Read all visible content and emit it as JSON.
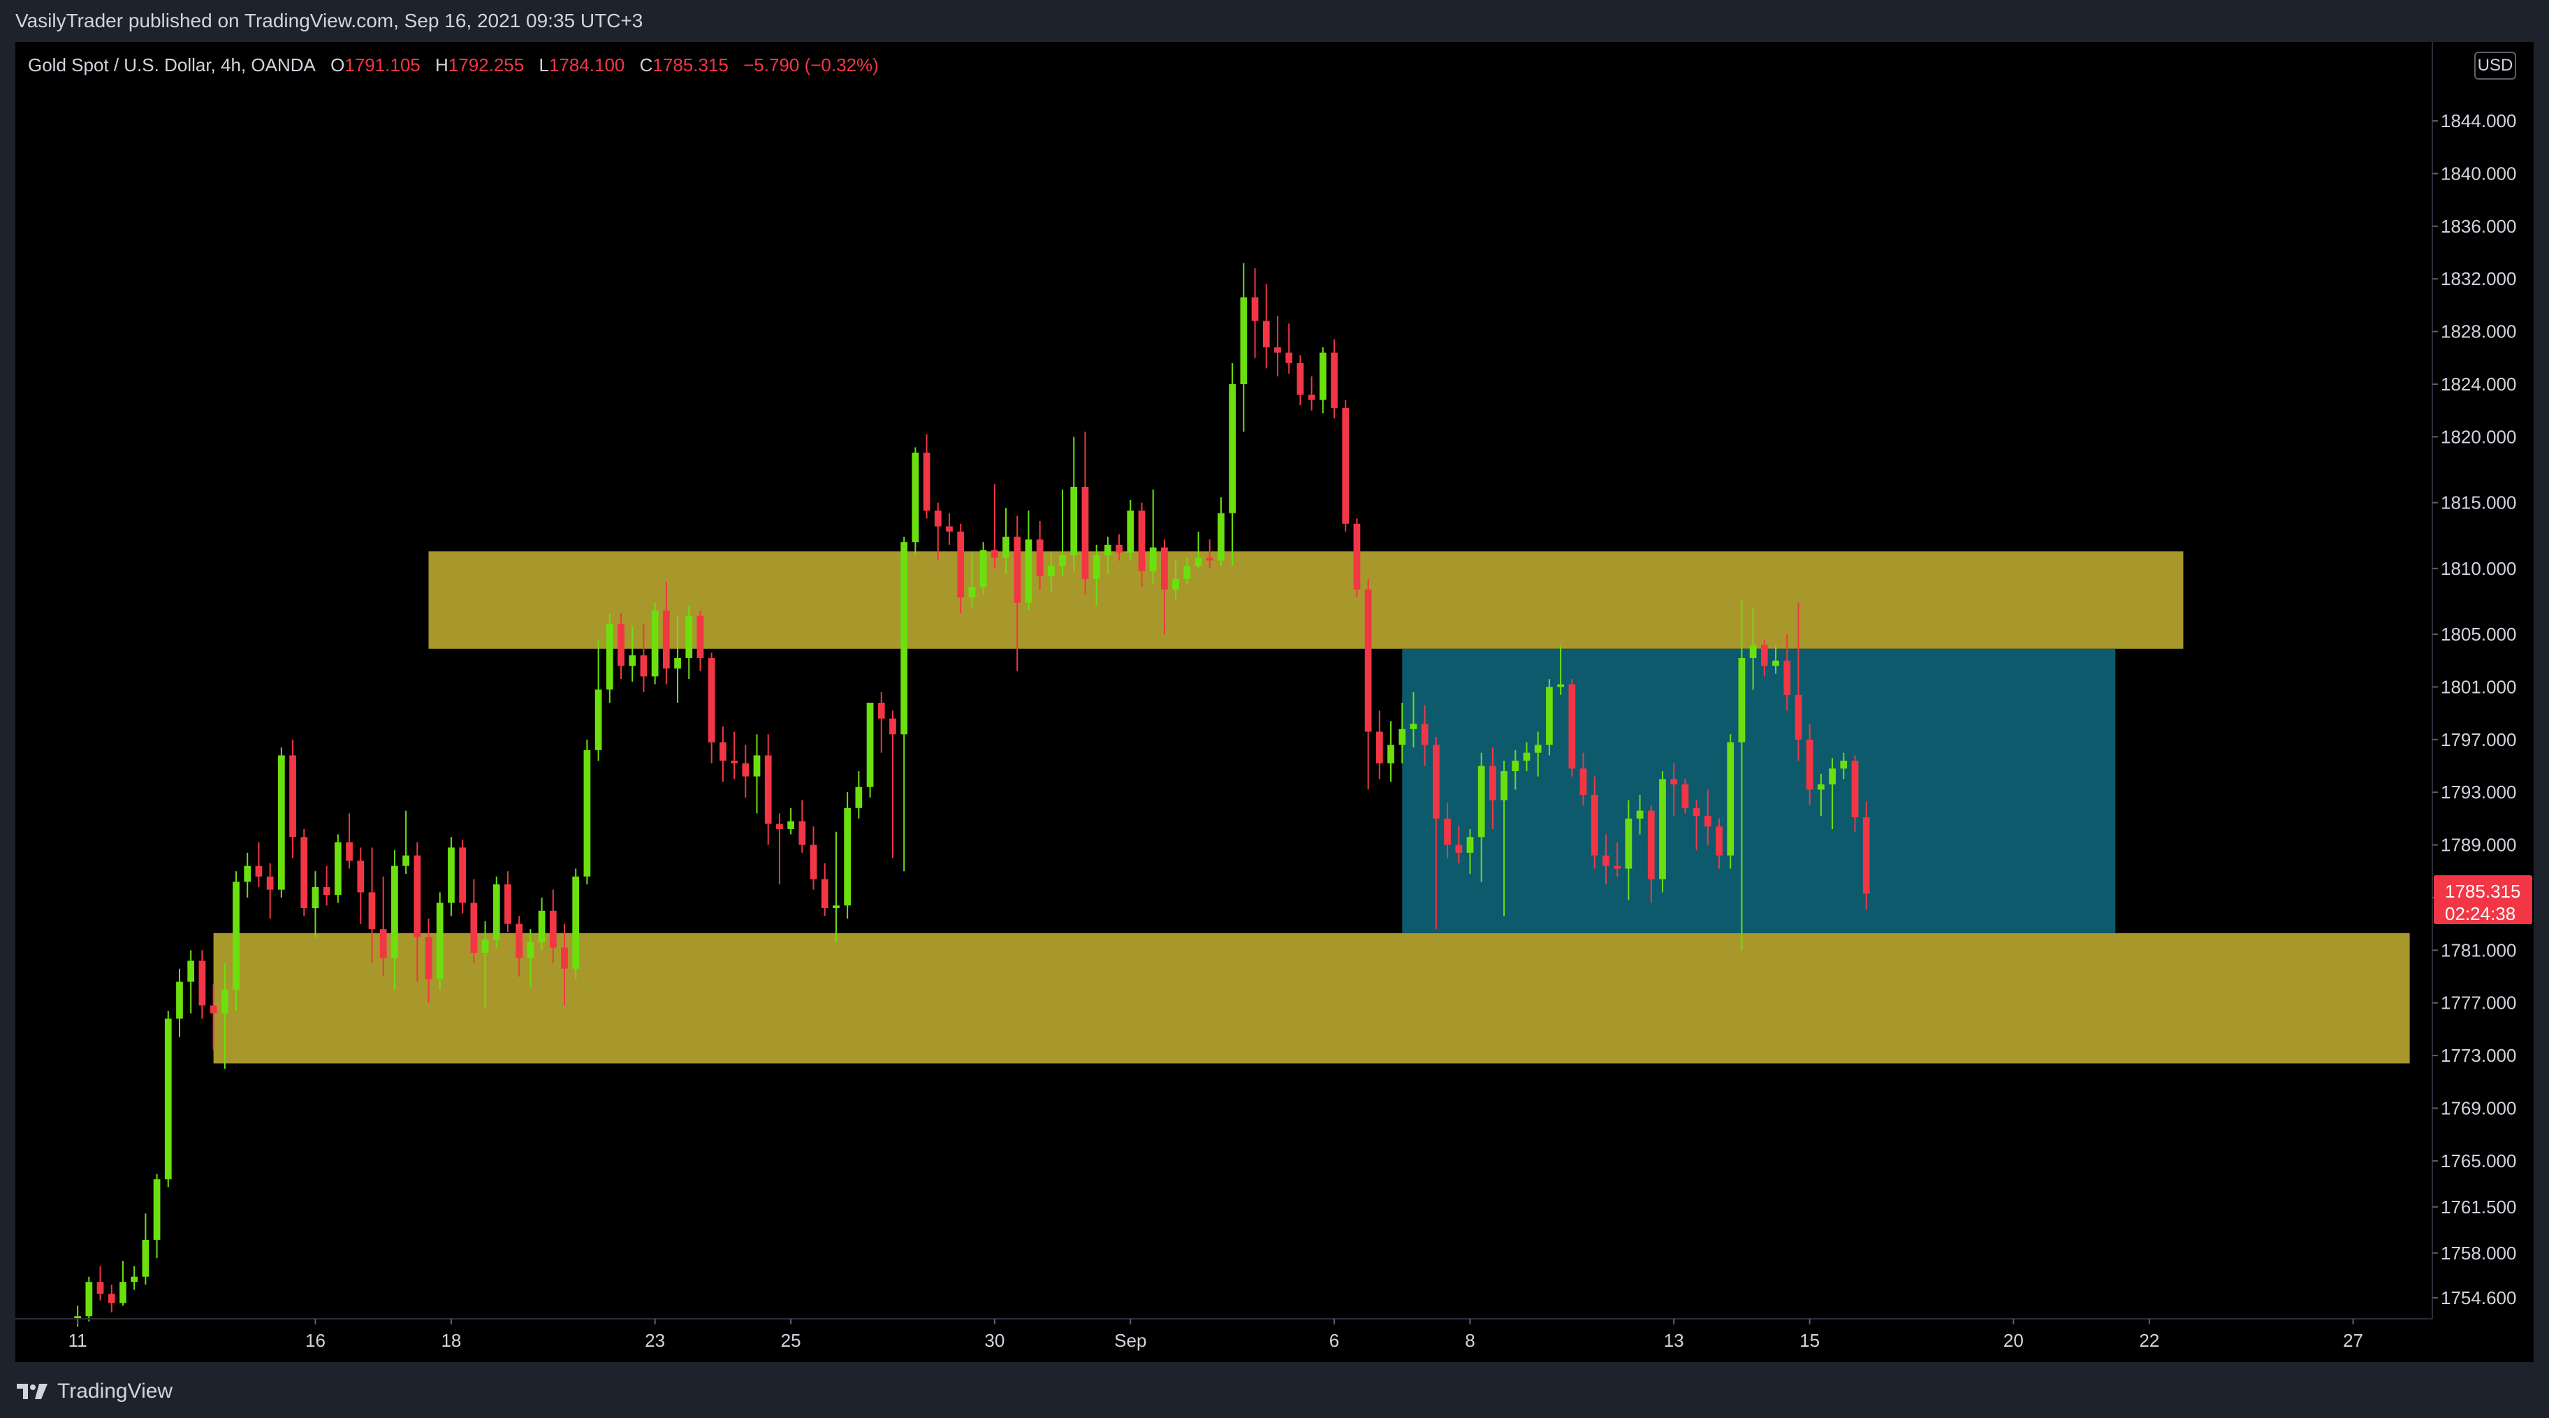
{
  "header": {
    "publisher": "VasilyTrader published on TradingView.com, Sep 16, 2021 09:35 UTC+3"
  },
  "legend": {
    "symbol": "Gold Spot / U.S. Dollar, 4h, OANDA",
    "o_label": "O",
    "o_value": "1791.105",
    "h_label": "H",
    "h_value": "1792.255",
    "l_label": "L",
    "l_value": "1784.100",
    "c_label": "C",
    "c_value": "1785.315",
    "change": "−5.790 (−0.32%)"
  },
  "currency": "USD",
  "footer": {
    "brand": "TradingView"
  },
  "colors": {
    "background": "#000000",
    "frame": "#1e222d",
    "up": "#6ce00f",
    "down": "#f23645",
    "zone": "#a8982b",
    "range_box": "#0e5a6d",
    "text": "#d1d4dc",
    "price_tag": "#f23645"
  },
  "chart_data": {
    "type": "candlestick",
    "symbol": "XAUUSD",
    "timeframe": "4h",
    "ylim": [
      1753.0,
      1850.0
    ],
    "y_ticks": [
      "1844.000",
      "1840.000",
      "1836.000",
      "1832.000",
      "1828.000",
      "1824.000",
      "1820.000",
      "1815.000",
      "1810.000",
      "1805.000",
      "1801.000",
      "1797.000",
      "1793.000",
      "1789.000",
      "1785.000",
      "1781.000",
      "1777.000",
      "1773.000",
      "1769.000",
      "1765.000",
      "1761.500",
      "1758.000",
      "1754.600"
    ],
    "x_ticks": [
      {
        "label": "11",
        "idx": 0
      },
      {
        "label": "16",
        "idx": 21
      },
      {
        "label": "18",
        "idx": 33
      },
      {
        "label": "23",
        "idx": 51
      },
      {
        "label": "25",
        "idx": 63
      },
      {
        "label": "30",
        "idx": 81
      },
      {
        "label": "Sep",
        "idx": 93
      },
      {
        "label": "6",
        "idx": 111
      },
      {
        "label": "8",
        "idx": 123
      },
      {
        "label": "13",
        "idx": 141
      },
      {
        "label": "15",
        "idx": 153
      },
      {
        "label": "20",
        "idx": 171
      },
      {
        "label": "22",
        "idx": 183
      },
      {
        "label": "27",
        "idx": 201
      }
    ],
    "x_index_range": [
      -5.5,
      208
    ],
    "last_price": {
      "value": "1785.315",
      "countdown": "02:24:38"
    },
    "zones": [
      {
        "name": "resistance-zone",
        "from_idx": 31,
        "to_idx": 186,
        "low": 1803.9,
        "high": 1811.3
      },
      {
        "name": "support-zone",
        "from_idx": 12,
        "to_idx": 206,
        "low": 1772.4,
        "high": 1782.3
      }
    ],
    "range_box": {
      "from_idx": 117,
      "to_idx": 180,
      "low": 1782.3,
      "high": 1803.9
    },
    "candles": [
      {
        "o": 1753.0,
        "h": 1754.0,
        "l": 1752.4,
        "c": 1753.2
      },
      {
        "o": 1753.2,
        "h": 1756.2,
        "l": 1752.8,
        "c": 1755.8
      },
      {
        "o": 1755.8,
        "h": 1757.0,
        "l": 1754.4,
        "c": 1754.9
      },
      {
        "o": 1754.9,
        "h": 1755.6,
        "l": 1753.5,
        "c": 1754.2
      },
      {
        "o": 1754.2,
        "h": 1757.4,
        "l": 1754.0,
        "c": 1755.8
      },
      {
        "o": 1755.8,
        "h": 1757.0,
        "l": 1755.2,
        "c": 1756.2
      },
      {
        "o": 1756.2,
        "h": 1761.0,
        "l": 1755.6,
        "c": 1759.0
      },
      {
        "o": 1759.0,
        "h": 1764.0,
        "l": 1757.6,
        "c": 1763.6
      },
      {
        "o": 1763.6,
        "h": 1776.4,
        "l": 1763.0,
        "c": 1775.8
      },
      {
        "o": 1775.8,
        "h": 1779.6,
        "l": 1774.4,
        "c": 1778.6
      },
      {
        "o": 1778.6,
        "h": 1781.0,
        "l": 1776.2,
        "c": 1780.2
      },
      {
        "o": 1780.2,
        "h": 1781.0,
        "l": 1775.8,
        "c": 1776.8
      },
      {
        "o": 1776.8,
        "h": 1778.4,
        "l": 1773.4,
        "c": 1776.2
      },
      {
        "o": 1776.2,
        "h": 1780.0,
        "l": 1772.0,
        "c": 1778.0
      },
      {
        "o": 1778.0,
        "h": 1787.0,
        "l": 1776.4,
        "c": 1786.2
      },
      {
        "o": 1786.2,
        "h": 1788.4,
        "l": 1785.0,
        "c": 1787.4
      },
      {
        "o": 1787.4,
        "h": 1789.2,
        "l": 1785.8,
        "c": 1786.6
      },
      {
        "o": 1786.6,
        "h": 1787.6,
        "l": 1783.4,
        "c": 1785.6
      },
      {
        "o": 1785.6,
        "h": 1796.4,
        "l": 1785.0,
        "c": 1795.8
      },
      {
        "o": 1795.8,
        "h": 1797.0,
        "l": 1788.0,
        "c": 1789.6
      },
      {
        "o": 1789.6,
        "h": 1790.2,
        "l": 1783.6,
        "c": 1784.2
      },
      {
        "o": 1784.2,
        "h": 1787.0,
        "l": 1782.0,
        "c": 1785.8
      },
      {
        "o": 1785.8,
        "h": 1787.4,
        "l": 1784.4,
        "c": 1785.2
      },
      {
        "o": 1785.2,
        "h": 1789.8,
        "l": 1784.6,
        "c": 1789.2
      },
      {
        "o": 1789.2,
        "h": 1791.4,
        "l": 1787.2,
        "c": 1787.8
      },
      {
        "o": 1787.8,
        "h": 1788.8,
        "l": 1783.0,
        "c": 1785.4
      },
      {
        "o": 1785.4,
        "h": 1788.8,
        "l": 1780.0,
        "c": 1782.6
      },
      {
        "o": 1782.6,
        "h": 1786.6,
        "l": 1779.0,
        "c": 1780.4
      },
      {
        "o": 1780.4,
        "h": 1788.6,
        "l": 1778.0,
        "c": 1787.4
      },
      {
        "o": 1787.4,
        "h": 1791.6,
        "l": 1786.8,
        "c": 1788.2
      },
      {
        "o": 1788.2,
        "h": 1789.2,
        "l": 1778.6,
        "c": 1782.0
      },
      {
        "o": 1782.0,
        "h": 1783.4,
        "l": 1777.0,
        "c": 1778.8
      },
      {
        "o": 1778.8,
        "h": 1785.4,
        "l": 1778.0,
        "c": 1784.6
      },
      {
        "o": 1784.6,
        "h": 1789.6,
        "l": 1783.6,
        "c": 1788.8
      },
      {
        "o": 1788.8,
        "h": 1789.4,
        "l": 1783.8,
        "c": 1784.6
      },
      {
        "o": 1784.6,
        "h": 1786.4,
        "l": 1780.0,
        "c": 1780.8
      },
      {
        "o": 1780.8,
        "h": 1783.2,
        "l": 1776.6,
        "c": 1781.8
      },
      {
        "o": 1781.8,
        "h": 1786.6,
        "l": 1781.2,
        "c": 1786.0
      },
      {
        "o": 1786.0,
        "h": 1787.0,
        "l": 1782.4,
        "c": 1783.0
      },
      {
        "o": 1783.0,
        "h": 1783.6,
        "l": 1779.0,
        "c": 1780.4
      },
      {
        "o": 1780.4,
        "h": 1782.6,
        "l": 1778.2,
        "c": 1781.6
      },
      {
        "o": 1781.6,
        "h": 1785.0,
        "l": 1781.0,
        "c": 1784.0
      },
      {
        "o": 1784.0,
        "h": 1785.6,
        "l": 1780.0,
        "c": 1781.2
      },
      {
        "o": 1781.2,
        "h": 1783.0,
        "l": 1776.8,
        "c": 1779.6
      },
      {
        "o": 1779.6,
        "h": 1787.2,
        "l": 1778.8,
        "c": 1786.6
      },
      {
        "o": 1786.6,
        "h": 1797.0,
        "l": 1786.0,
        "c": 1796.2
      },
      {
        "o": 1796.2,
        "h": 1804.6,
        "l": 1795.4,
        "c": 1800.8
      },
      {
        "o": 1800.8,
        "h": 1806.6,
        "l": 1799.8,
        "c": 1805.8
      },
      {
        "o": 1805.8,
        "h": 1806.6,
        "l": 1801.6,
        "c": 1802.6
      },
      {
        "o": 1802.6,
        "h": 1805.6,
        "l": 1801.4,
        "c": 1803.4
      },
      {
        "o": 1803.4,
        "h": 1805.8,
        "l": 1800.6,
        "c": 1801.8
      },
      {
        "o": 1801.8,
        "h": 1807.4,
        "l": 1801.2,
        "c": 1806.8
      },
      {
        "o": 1806.8,
        "h": 1809.0,
        "l": 1801.2,
        "c": 1802.4
      },
      {
        "o": 1802.4,
        "h": 1806.4,
        "l": 1799.8,
        "c": 1803.2
      },
      {
        "o": 1803.2,
        "h": 1807.2,
        "l": 1801.6,
        "c": 1806.4
      },
      {
        "o": 1806.4,
        "h": 1806.8,
        "l": 1802.2,
        "c": 1803.2
      },
      {
        "o": 1803.2,
        "h": 1803.6,
        "l": 1795.2,
        "c": 1796.8
      },
      {
        "o": 1796.8,
        "h": 1798.0,
        "l": 1793.8,
        "c": 1795.4
      },
      {
        "o": 1795.4,
        "h": 1797.6,
        "l": 1794.0,
        "c": 1795.2
      },
      {
        "o": 1795.2,
        "h": 1796.6,
        "l": 1792.6,
        "c": 1794.2
      },
      {
        "o": 1794.2,
        "h": 1797.4,
        "l": 1791.4,
        "c": 1795.8
      },
      {
        "o": 1795.8,
        "h": 1797.4,
        "l": 1789.0,
        "c": 1790.6
      },
      {
        "o": 1790.6,
        "h": 1791.4,
        "l": 1786.0,
        "c": 1790.2
      },
      {
        "o": 1790.2,
        "h": 1791.8,
        "l": 1789.8,
        "c": 1790.8
      },
      {
        "o": 1790.8,
        "h": 1792.4,
        "l": 1788.4,
        "c": 1789.0
      },
      {
        "o": 1789.0,
        "h": 1790.4,
        "l": 1785.6,
        "c": 1786.4
      },
      {
        "o": 1786.4,
        "h": 1787.6,
        "l": 1783.6,
        "c": 1784.2
      },
      {
        "o": 1784.2,
        "h": 1790.0,
        "l": 1781.6,
        "c": 1784.4
      },
      {
        "o": 1784.4,
        "h": 1793.0,
        "l": 1783.4,
        "c": 1791.8
      },
      {
        "o": 1791.8,
        "h": 1794.6,
        "l": 1791.0,
        "c": 1793.4
      },
      {
        "o": 1793.4,
        "h": 1799.8,
        "l": 1792.6,
        "c": 1799.8
      },
      {
        "o": 1799.8,
        "h": 1800.6,
        "l": 1796.0,
        "c": 1798.6
      },
      {
        "o": 1798.6,
        "h": 1799.2,
        "l": 1788.0,
        "c": 1797.4
      },
      {
        "o": 1797.4,
        "h": 1812.4,
        "l": 1787.0,
        "c": 1812.0
      },
      {
        "o": 1812.0,
        "h": 1819.2,
        "l": 1811.0,
        "c": 1818.8
      },
      {
        "o": 1818.8,
        "h": 1820.2,
        "l": 1813.8,
        "c": 1814.4
      },
      {
        "o": 1814.4,
        "h": 1815.0,
        "l": 1810.6,
        "c": 1813.2
      },
      {
        "o": 1813.2,
        "h": 1814.2,
        "l": 1811.8,
        "c": 1812.8
      },
      {
        "o": 1812.8,
        "h": 1813.4,
        "l": 1806.6,
        "c": 1807.8
      },
      {
        "o": 1807.8,
        "h": 1811.2,
        "l": 1807.0,
        "c": 1808.6
      },
      {
        "o": 1808.6,
        "h": 1812.0,
        "l": 1808.0,
        "c": 1811.4
      },
      {
        "o": 1811.4,
        "h": 1816.4,
        "l": 1810.0,
        "c": 1810.8
      },
      {
        "o": 1810.8,
        "h": 1814.6,
        "l": 1809.6,
        "c": 1812.4
      },
      {
        "o": 1812.4,
        "h": 1814.0,
        "l": 1802.2,
        "c": 1807.4
      },
      {
        "o": 1807.4,
        "h": 1814.4,
        "l": 1806.8,
        "c": 1812.2
      },
      {
        "o": 1812.2,
        "h": 1813.6,
        "l": 1808.4,
        "c": 1809.4
      },
      {
        "o": 1809.4,
        "h": 1811.2,
        "l": 1808.2,
        "c": 1810.2
      },
      {
        "o": 1810.2,
        "h": 1816.0,
        "l": 1809.4,
        "c": 1811.0
      },
      {
        "o": 1811.0,
        "h": 1820.0,
        "l": 1809.8,
        "c": 1816.2
      },
      {
        "o": 1816.2,
        "h": 1820.4,
        "l": 1808.0,
        "c": 1809.2
      },
      {
        "o": 1809.2,
        "h": 1811.8,
        "l": 1807.2,
        "c": 1811.0
      },
      {
        "o": 1811.0,
        "h": 1812.4,
        "l": 1809.6,
        "c": 1811.8
      },
      {
        "o": 1811.8,
        "h": 1812.6,
        "l": 1810.6,
        "c": 1811.2
      },
      {
        "o": 1811.2,
        "h": 1815.2,
        "l": 1810.6,
        "c": 1814.4
      },
      {
        "o": 1814.4,
        "h": 1815.0,
        "l": 1808.6,
        "c": 1809.8
      },
      {
        "o": 1809.8,
        "h": 1816.0,
        "l": 1808.8,
        "c": 1811.6
      },
      {
        "o": 1811.6,
        "h": 1812.2,
        "l": 1805.0,
        "c": 1808.4
      },
      {
        "o": 1808.4,
        "h": 1810.6,
        "l": 1807.6,
        "c": 1809.2
      },
      {
        "o": 1809.2,
        "h": 1810.8,
        "l": 1808.8,
        "c": 1810.2
      },
      {
        "o": 1810.2,
        "h": 1812.8,
        "l": 1810.0,
        "c": 1810.8
      },
      {
        "o": 1810.8,
        "h": 1812.2,
        "l": 1810.0,
        "c": 1810.6
      },
      {
        "o": 1810.6,
        "h": 1815.4,
        "l": 1810.2,
        "c": 1814.2
      },
      {
        "o": 1814.2,
        "h": 1825.6,
        "l": 1810.2,
        "c": 1824.0
      },
      {
        "o": 1824.0,
        "h": 1833.2,
        "l": 1820.4,
        "c": 1830.6
      },
      {
        "o": 1830.6,
        "h": 1832.8,
        "l": 1826.0,
        "c": 1828.8
      },
      {
        "o": 1828.8,
        "h": 1831.6,
        "l": 1825.2,
        "c": 1826.8
      },
      {
        "o": 1826.8,
        "h": 1829.2,
        "l": 1824.6,
        "c": 1826.4
      },
      {
        "o": 1826.4,
        "h": 1828.6,
        "l": 1824.8,
        "c": 1825.6
      },
      {
        "o": 1825.6,
        "h": 1826.2,
        "l": 1822.4,
        "c": 1823.2
      },
      {
        "o": 1823.2,
        "h": 1824.6,
        "l": 1822.0,
        "c": 1822.8
      },
      {
        "o": 1822.8,
        "h": 1826.8,
        "l": 1821.8,
        "c": 1826.4
      },
      {
        "o": 1826.4,
        "h": 1827.4,
        "l": 1821.4,
        "c": 1822.2
      },
      {
        "o": 1822.2,
        "h": 1822.8,
        "l": 1812.8,
        "c": 1813.4
      },
      {
        "o": 1813.4,
        "h": 1813.8,
        "l": 1807.8,
        "c": 1808.4
      },
      {
        "o": 1808.4,
        "h": 1809.2,
        "l": 1793.2,
        "c": 1797.6
      },
      {
        "o": 1797.6,
        "h": 1799.2,
        "l": 1794.0,
        "c": 1795.2
      },
      {
        "o": 1795.2,
        "h": 1798.4,
        "l": 1793.8,
        "c": 1796.6
      },
      {
        "o": 1796.6,
        "h": 1799.8,
        "l": 1795.2,
        "c": 1797.8
      },
      {
        "o": 1797.8,
        "h": 1800.6,
        "l": 1796.4,
        "c": 1798.2
      },
      {
        "o": 1798.2,
        "h": 1799.6,
        "l": 1795.0,
        "c": 1796.6
      },
      {
        "o": 1796.6,
        "h": 1797.2,
        "l": 1782.6,
        "c": 1791.0
      },
      {
        "o": 1791.0,
        "h": 1792.2,
        "l": 1788.0,
        "c": 1789.0
      },
      {
        "o": 1789.0,
        "h": 1790.4,
        "l": 1787.6,
        "c": 1788.4
      },
      {
        "o": 1788.4,
        "h": 1790.2,
        "l": 1786.8,
        "c": 1789.6
      },
      {
        "o": 1789.6,
        "h": 1796.0,
        "l": 1786.2,
        "c": 1795.0
      },
      {
        "o": 1795.0,
        "h": 1796.4,
        "l": 1790.2,
        "c": 1792.4
      },
      {
        "o": 1792.4,
        "h": 1795.4,
        "l": 1783.6,
        "c": 1794.6
      },
      {
        "o": 1794.6,
        "h": 1796.2,
        "l": 1793.2,
        "c": 1795.4
      },
      {
        "o": 1795.4,
        "h": 1796.8,
        "l": 1794.6,
        "c": 1796.0
      },
      {
        "o": 1796.0,
        "h": 1797.6,
        "l": 1794.2,
        "c": 1796.6
      },
      {
        "o": 1796.6,
        "h": 1801.6,
        "l": 1795.8,
        "c": 1801.0
      },
      {
        "o": 1801.0,
        "h": 1804.2,
        "l": 1800.4,
        "c": 1801.2
      },
      {
        "o": 1801.2,
        "h": 1801.6,
        "l": 1794.2,
        "c": 1794.8
      },
      {
        "o": 1794.8,
        "h": 1796.0,
        "l": 1792.0,
        "c": 1792.8
      },
      {
        "o": 1792.8,
        "h": 1794.2,
        "l": 1787.2,
        "c": 1788.2
      },
      {
        "o": 1788.2,
        "h": 1789.8,
        "l": 1786.0,
        "c": 1787.4
      },
      {
        "o": 1787.4,
        "h": 1789.2,
        "l": 1786.6,
        "c": 1787.2
      },
      {
        "o": 1787.2,
        "h": 1792.4,
        "l": 1784.8,
        "c": 1791.0
      },
      {
        "o": 1791.0,
        "h": 1792.8,
        "l": 1789.8,
        "c": 1791.6
      },
      {
        "o": 1791.6,
        "h": 1792.0,
        "l": 1784.6,
        "c": 1786.4
      },
      {
        "o": 1786.4,
        "h": 1794.6,
        "l": 1785.4,
        "c": 1794.0
      },
      {
        "o": 1794.0,
        "h": 1795.2,
        "l": 1791.2,
        "c": 1793.6
      },
      {
        "o": 1793.6,
        "h": 1794.0,
        "l": 1791.4,
        "c": 1791.8
      },
      {
        "o": 1791.8,
        "h": 1792.4,
        "l": 1788.6,
        "c": 1791.2
      },
      {
        "o": 1791.2,
        "h": 1793.2,
        "l": 1789.0,
        "c": 1790.4
      },
      {
        "o": 1790.4,
        "h": 1791.0,
        "l": 1787.2,
        "c": 1788.2
      },
      {
        "o": 1788.2,
        "h": 1797.4,
        "l": 1787.2,
        "c": 1796.8
      },
      {
        "o": 1796.8,
        "h": 1807.6,
        "l": 1781.0,
        "c": 1803.2
      },
      {
        "o": 1803.2,
        "h": 1807.0,
        "l": 1800.8,
        "c": 1804.2
      },
      {
        "o": 1804.2,
        "h": 1804.6,
        "l": 1801.8,
        "c": 1802.6
      },
      {
        "o": 1802.6,
        "h": 1804.2,
        "l": 1802.0,
        "c": 1803.0
      },
      {
        "o": 1803.0,
        "h": 1805.0,
        "l": 1799.2,
        "c": 1800.4
      },
      {
        "o": 1800.4,
        "h": 1807.4,
        "l": 1795.4,
        "c": 1797.0
      },
      {
        "o": 1797.0,
        "h": 1798.2,
        "l": 1792.0,
        "c": 1793.2
      },
      {
        "o": 1793.2,
        "h": 1794.4,
        "l": 1791.2,
        "c": 1793.6
      },
      {
        "o": 1793.6,
        "h": 1795.6,
        "l": 1790.2,
        "c": 1794.8
      },
      {
        "o": 1794.8,
        "h": 1796.0,
        "l": 1794.0,
        "c": 1795.4
      },
      {
        "o": 1795.4,
        "h": 1795.8,
        "l": 1790.0,
        "c": 1791.1
      },
      {
        "o": 1791.1,
        "h": 1792.3,
        "l": 1784.1,
        "c": 1785.3
      }
    ]
  }
}
